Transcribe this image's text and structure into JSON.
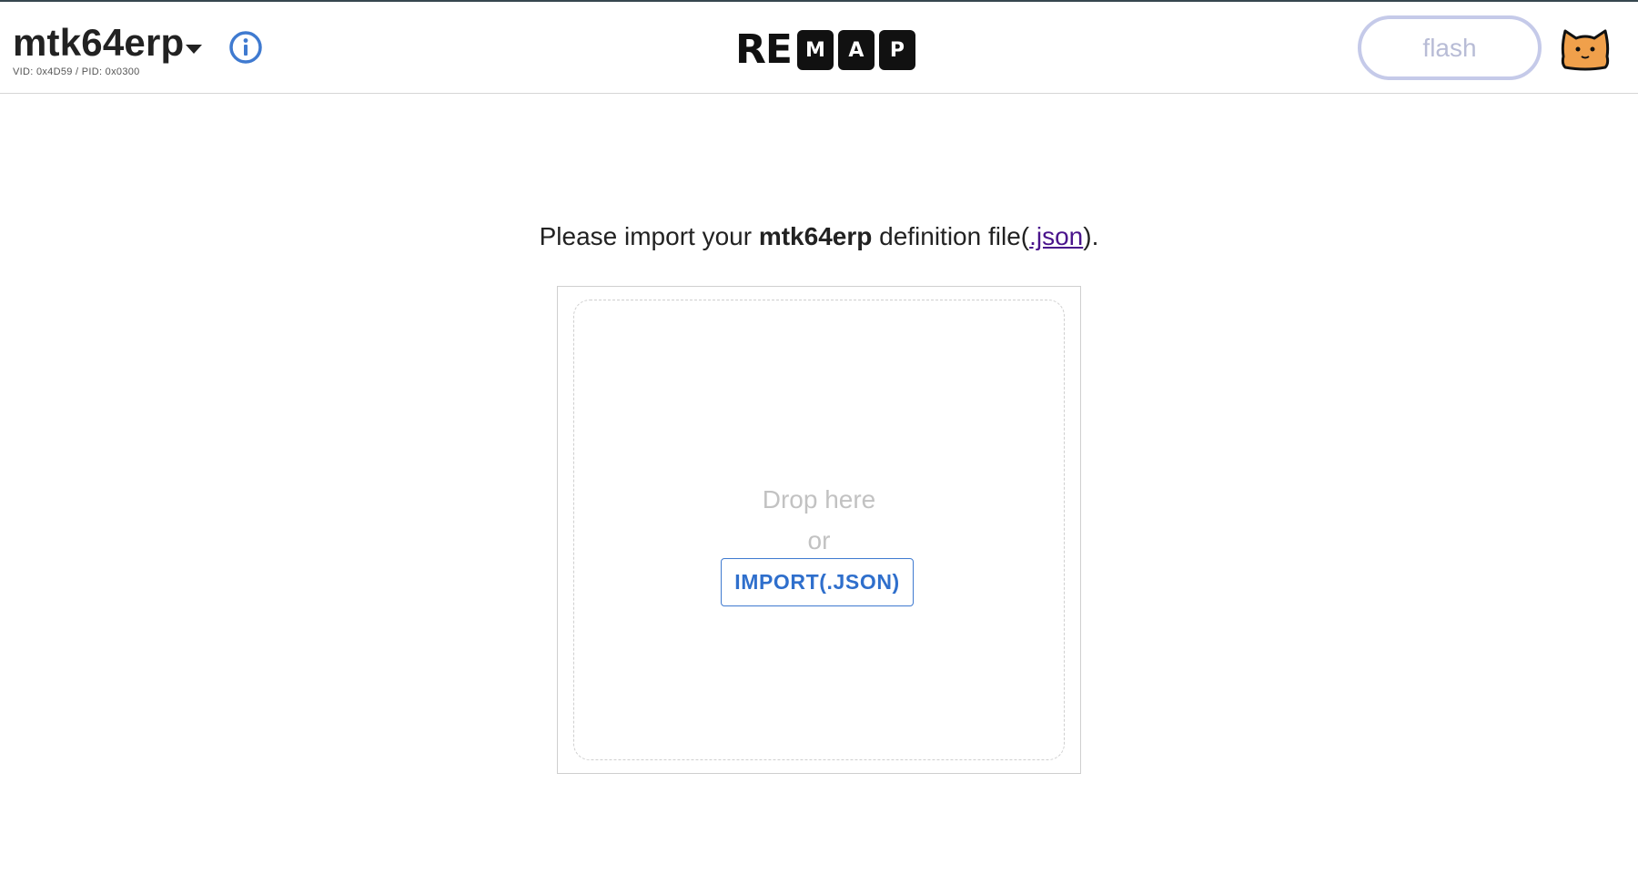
{
  "header": {
    "keyboard_name": "mtk64erp",
    "vid_pid": "VID: 0x4D59 / PID: 0x0300",
    "info_icon": "info-circle-icon",
    "dropdown_icon": "caret-down-icon",
    "logo": {
      "plain": "RE",
      "boxed": [
        "M",
        "A",
        "P"
      ]
    },
    "flash_label": "flash",
    "avatar_icon": "cat-avatar-icon",
    "colors": {
      "topline": "#37474f",
      "info": "#3f7ad0",
      "flash_border": "#c5cae9",
      "avatar": "#f0a04b"
    }
  },
  "main": {
    "prompt_prefix": "Please import your ",
    "prompt_keyboard": "mtk64erp",
    "prompt_middle": " definition file(",
    "prompt_link": ".json",
    "prompt_suffix": ").",
    "drop_text": "Drop here",
    "or_text": "or",
    "import_label": "IMPORT(.JSON)"
  }
}
